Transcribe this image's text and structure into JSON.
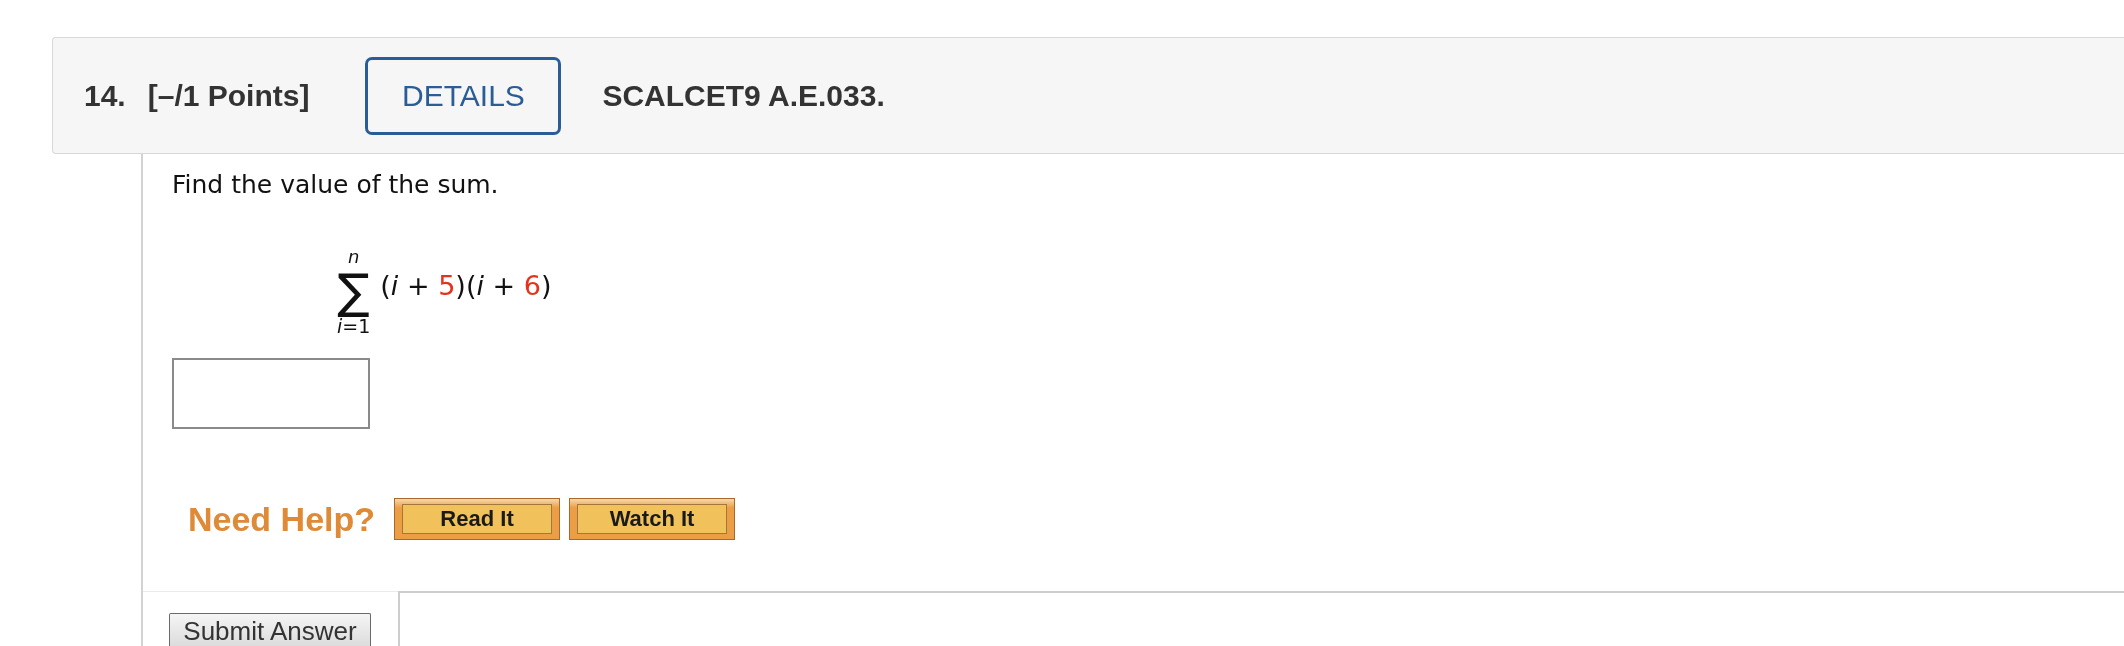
{
  "question": {
    "number": "14.",
    "points": "[–/1 Points]",
    "details_button": "DETAILS",
    "source": "SCALCET9 A.E.033."
  },
  "prompt": "Find the value of the sum.",
  "sum": {
    "operator": "∑",
    "upper": "n",
    "lower": "*i*=1",
    "expression": [
      {
        "text": "(",
        "kind": "plain"
      },
      {
        "text": "i",
        "kind": "variable"
      },
      {
        "text": " + ",
        "kind": "plain"
      },
      {
        "text": "5",
        "kind": "given"
      },
      {
        "text": ")(",
        "kind": "plain"
      },
      {
        "text": "i",
        "kind": "variable"
      },
      {
        "text": " + ",
        "kind": "plain"
      },
      {
        "text": "6",
        "kind": "given"
      },
      {
        "text": ")",
        "kind": "plain"
      }
    ]
  },
  "help": {
    "label": "Need Help?",
    "buttons": [
      "Read It",
      "Watch It"
    ]
  },
  "submit_button": "Submit Answer"
}
